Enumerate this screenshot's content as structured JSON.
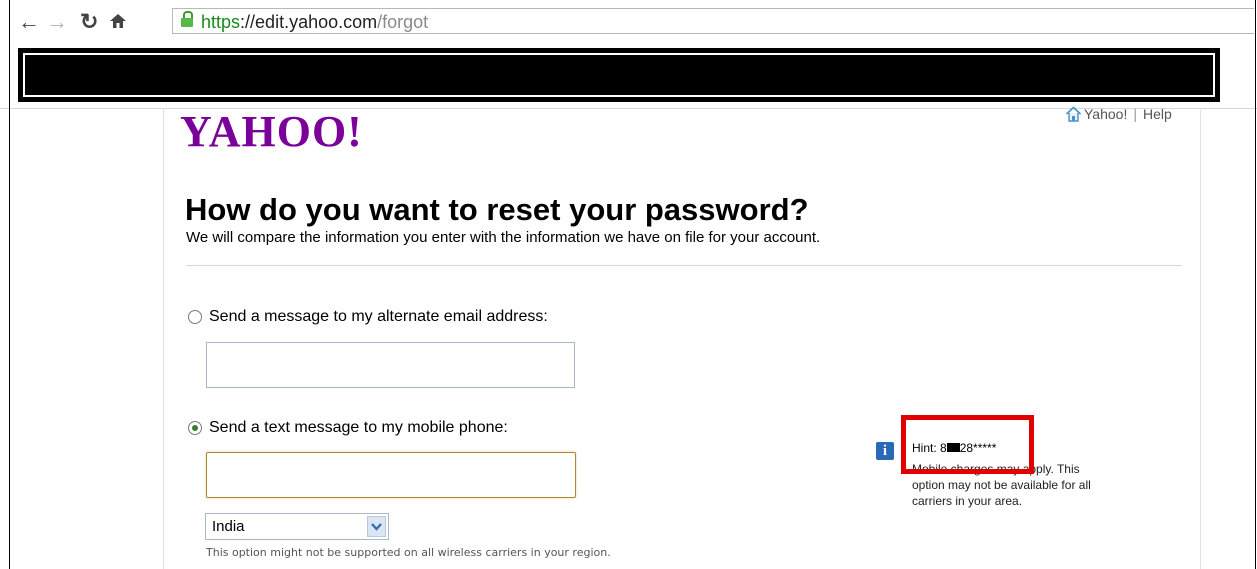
{
  "browser": {
    "url_scheme": "https",
    "url_sep": "://",
    "url_host": "edit.yahoo.com",
    "url_path": "/forgot"
  },
  "header": {
    "logo": "YAHOO!",
    "link_yahoo": "Yahoo!",
    "separator": "|",
    "link_help": "Help"
  },
  "main": {
    "title": "How do you want to reset your password?",
    "subtitle": "We will compare the information you enter with the information we have on file for your account.",
    "option_email": {
      "label": "Send a message to my alternate email address:",
      "value": "",
      "selected": false
    },
    "option_sms": {
      "label": "Send a text message to my mobile phone:",
      "value": "",
      "selected": true
    },
    "country": {
      "selected": "India"
    },
    "carrier_note": "This option might not be supported on all wireless carriers in your region."
  },
  "hint": {
    "prefix": "Hint: 8",
    "suffix": "28*****",
    "body": "Mobile charges may apply. This option may not be available for all carriers in your area."
  },
  "colors": {
    "yahoo_purple": "#7b0099",
    "annotation_red": "#e00000",
    "secure_green": "#1a8a1a"
  }
}
